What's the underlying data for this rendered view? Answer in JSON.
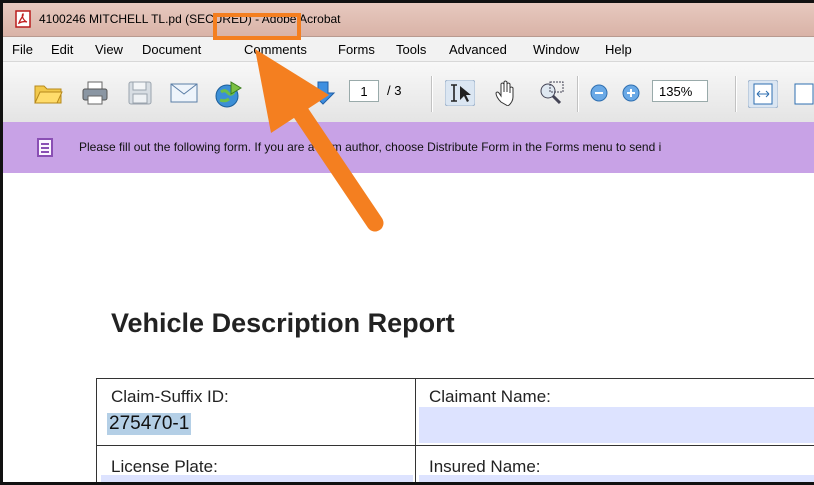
{
  "window": {
    "title_prefix": "4100246 MITCHELL TL.pd ",
    "title_secured": "(SECURED)",
    "title_suffix": " - Adobe Acrobat"
  },
  "menu": [
    "File",
    "Edit",
    "View",
    "Document",
    "Comments",
    "Forms",
    "Tools",
    "Advanced",
    "Window",
    "Help"
  ],
  "toolbar": {
    "page_current": "1",
    "page_total": "/ 3",
    "zoom": "135%"
  },
  "infobar": {
    "message": "Please fill out the following form. If you are a form author, choose Distribute Form in the Forms menu to send i"
  },
  "document": {
    "title": "Vehicle Description Report",
    "fields": {
      "claim_suffix_label": "Claim-Suffix ID:",
      "claim_suffix_value": "275470-1",
      "claimant_name_label": "Claimant Name:",
      "license_plate_label": "License Plate:",
      "insured_name_label": "Insured Name:"
    }
  },
  "annotation": {
    "color": "#f47f20",
    "target": "title_secured"
  }
}
